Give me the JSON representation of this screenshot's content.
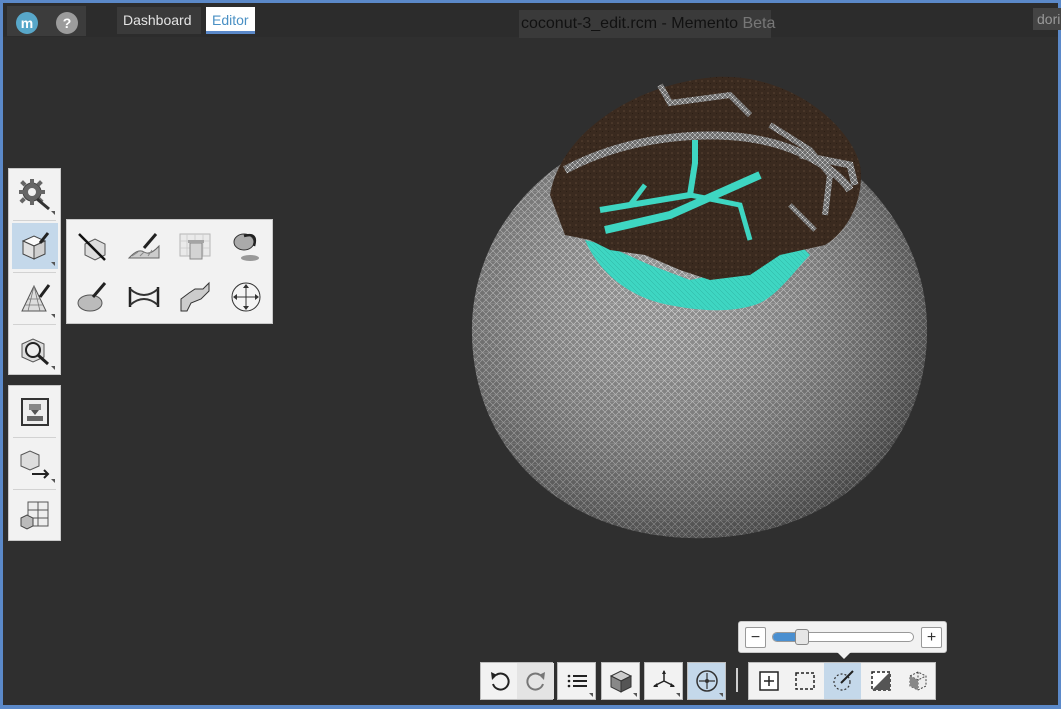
{
  "app": {
    "logo_glyph": "m",
    "help_glyph": "?",
    "window_title": "coconut-3_edit.rcm - Memento",
    "window_title_suffix": "Beta",
    "user_label": "dorin"
  },
  "tabs": [
    {
      "label": "Dashboard",
      "active": false
    },
    {
      "label": "Editor",
      "active": true
    }
  ],
  "palette_top": [
    {
      "name": "settings",
      "icon": "gear-wrench-icon",
      "active": false
    },
    {
      "name": "edit",
      "icon": "cube-brush-icon",
      "active": true
    },
    {
      "name": "mesh-edit",
      "icon": "mesh-pyramid-brush-icon",
      "active": false
    },
    {
      "name": "analyze",
      "icon": "cube-magnifier-icon",
      "active": false
    }
  ],
  "palette_bottom": [
    {
      "name": "print",
      "icon": "print-box-icon"
    },
    {
      "name": "export",
      "icon": "cube-arrow-export-icon"
    },
    {
      "name": "layout",
      "icon": "grid-cube-layout-icon"
    }
  ],
  "edit_flyout": [
    {
      "name": "slice",
      "icon": "cube-knife-icon"
    },
    {
      "name": "sculpt",
      "icon": "mesh-brush-icon"
    },
    {
      "name": "delete",
      "icon": "mesh-trash-icon"
    },
    {
      "name": "fill",
      "icon": "bucket-fill-icon"
    },
    {
      "name": "smooth",
      "icon": "eraser-smooth-icon"
    },
    {
      "name": "bridge",
      "icon": "bridge-hole-icon"
    },
    {
      "name": "extrude",
      "icon": "extrude-profile-icon"
    },
    {
      "name": "transform",
      "icon": "move-arrows-icon"
    }
  ],
  "zoom": {
    "minus_glyph": "−",
    "plus_glyph": "+",
    "level": 0.18
  },
  "toolbar": [
    {
      "name": "undo",
      "icon": "undo-icon"
    },
    {
      "name": "redo",
      "icon": "redo-icon"
    },
    {
      "name": "list",
      "icon": "list-icon"
    },
    {
      "name": "view-cube",
      "icon": "view-cube-icon"
    },
    {
      "name": "axes",
      "icon": "axes-icon"
    },
    {
      "name": "orbit",
      "icon": "orbit-center-icon",
      "active": true
    },
    {
      "name": "select-box",
      "icon": "select-box-plus-icon"
    },
    {
      "name": "select-marquee",
      "icon": "select-dashed-icon"
    },
    {
      "name": "select-brush",
      "icon": "select-brush-icon",
      "active": true
    },
    {
      "name": "select-invert",
      "icon": "select-invert-icon"
    },
    {
      "name": "select-backface",
      "icon": "select-cube-icon"
    }
  ],
  "colors": {
    "accent": "#5b89c9",
    "selection": "#3ed6c2",
    "mesh_top": "#3a2a1f",
    "mesh_wire": "#cfcfcf",
    "background": "#2f2f2f"
  }
}
